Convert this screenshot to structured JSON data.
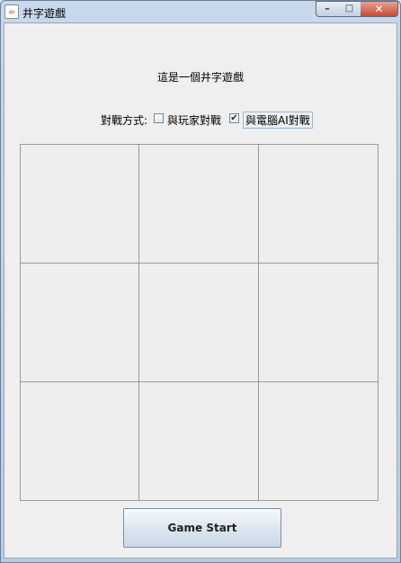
{
  "window": {
    "title": "井字遊戲",
    "icon": "java-cup-icon",
    "controls": {
      "minimize": "minimize-icon",
      "maximize": "maximize-icon",
      "close": "close-icon"
    }
  },
  "header": {
    "message": "這是一個井字遊戲"
  },
  "mode": {
    "label": "對戰方式:",
    "options": [
      {
        "label": "與玩家對戰",
        "checked": false
      },
      {
        "label": "與電腦AI對戰",
        "checked": true
      }
    ]
  },
  "board": {
    "cells": [
      "",
      "",
      "",
      "",
      "",
      "",
      "",
      "",
      ""
    ]
  },
  "actions": {
    "start_label": "Game Start"
  }
}
